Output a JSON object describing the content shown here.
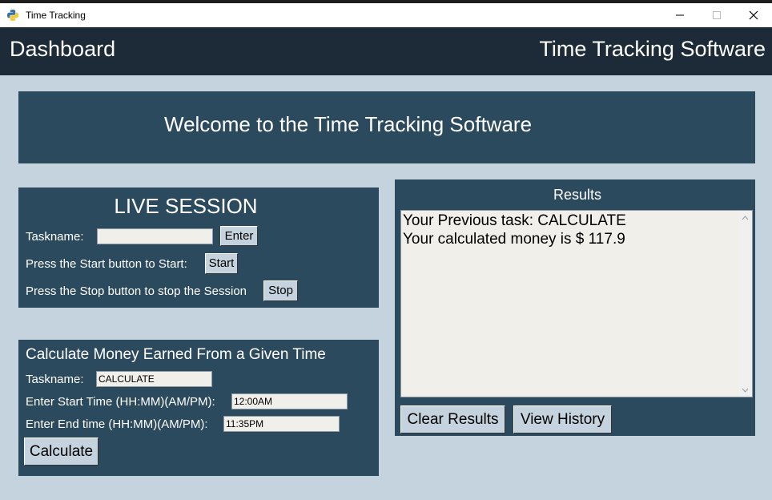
{
  "window": {
    "title": "Time Tracking"
  },
  "header": {
    "left": "Dashboard",
    "right": "Time Tracking Software"
  },
  "welcome": {
    "text": "Welcome to the Time Tracking Software"
  },
  "live_session": {
    "heading": "LIVE SESSION",
    "taskname_label": "Taskname:",
    "taskname_value": "",
    "enter_button": "Enter",
    "start_label": "Press the Start button to Start:",
    "start_button": "Start",
    "stop_label": "Press the Stop button to stop the Session",
    "stop_button": "Stop"
  },
  "calculate": {
    "heading": "Calculate Money Earned From a Given Time",
    "taskname_label": "Taskname:",
    "taskname_value": "CALCULATE",
    "start_label": "Enter Start Time (HH:MM)(AM/PM):",
    "start_value": "12:00AM",
    "end_label": "Enter End time (HH:MM)(AM/PM):",
    "end_value": "11:35PM",
    "calculate_button": "Calculate"
  },
  "results": {
    "heading": "Results",
    "lines": [
      "Your Previous task: CALCULATE",
      "Your calculated money is $ 117.9"
    ],
    "clear_button": "Clear Results",
    "history_button": "View History"
  },
  "colors": {
    "background": "#c5d3de",
    "panel": "#2c4a5e",
    "header": "#1d2a38",
    "input": "#f1efe9"
  }
}
